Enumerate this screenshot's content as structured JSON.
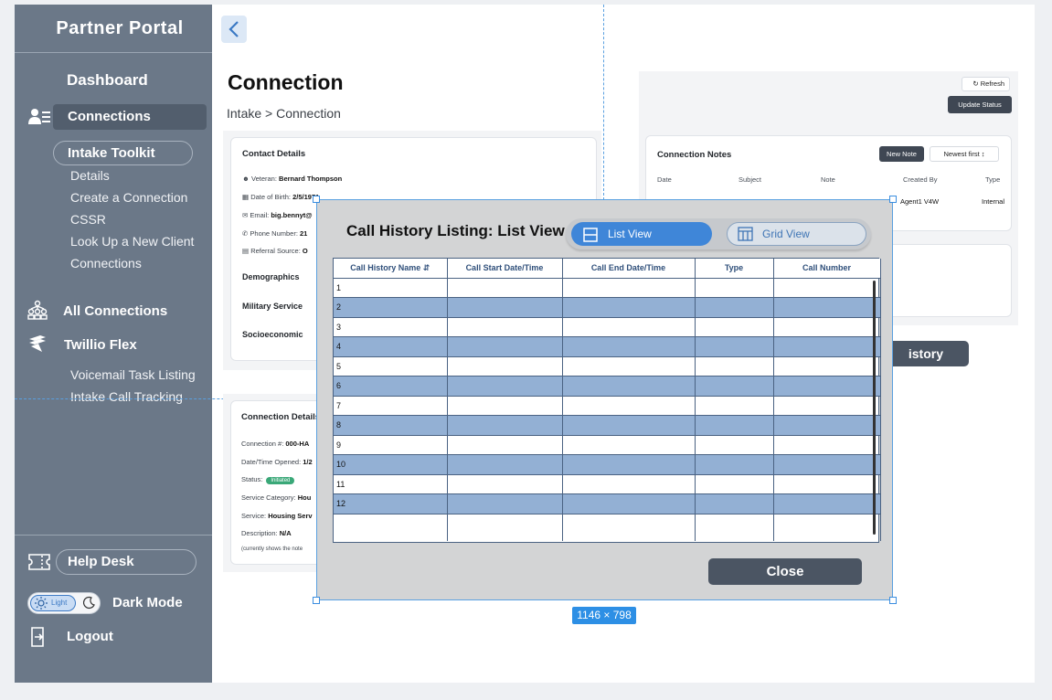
{
  "sidebar": {
    "brand": "Partner Portal",
    "dashboard": "Dashboard",
    "connections": "Connections",
    "intake_toolkit": "Intake Toolkit",
    "sub_items": [
      "Details",
      "Create a Connection",
      "CSSR",
      "Look Up a New Client",
      "Connections"
    ],
    "all_connections": "All Connections",
    "twilio_flex": "Twillio Flex",
    "flex_items": [
      "Voicemail Task Listing",
      "Intake Call Tracking"
    ],
    "help_desk": "Help Desk",
    "toggle_light": "Light",
    "dark_mode": "Dark Mode",
    "logout": "Logout"
  },
  "main": {
    "title": "Connection",
    "breadcrumb": "Intake > Connection",
    "contact": {
      "title": "Contact Details",
      "veteran_label": "Veteran:",
      "veteran": "Bernard Thompson",
      "dob_label": "Date of Birth:",
      "dob": "2/5/1971",
      "email_label": "Email:",
      "email": "big.bennyt@",
      "phone_label": "Phone Number:",
      "phone": "21",
      "referral_label": "Referral Source:",
      "referral": "O",
      "sections": [
        "Demographics",
        "Military Service",
        "Socioeconomic"
      ]
    },
    "connection": {
      "title": "Connection Details",
      "number_label": "Connection #:",
      "number": "000-HA",
      "opened_label": "Date/Time Opened:",
      "opened": "1/2",
      "status_label": "Status:",
      "status": "Initiated",
      "category_label": "Service Category:",
      "category": "Hou",
      "service_label": "Service:",
      "service": "Housing Serv",
      "description_label": "Description:",
      "description": "N/A",
      "note": "(currently shows the note"
    },
    "right": {
      "refresh": "Refresh",
      "update_status": "Update Status",
      "notes_title": "Connection Notes",
      "new_note": "New Note",
      "newest_first": "Newest first",
      "notes_columns": [
        "Date",
        "Subject",
        "Note",
        "Created By",
        "Type"
      ],
      "note_row": {
        "created_by": "Agent1 V4W",
        "type": "Internal"
      },
      "history_button": "istory"
    }
  },
  "modal": {
    "title": "Call History Listing: List View",
    "list_view": "List View",
    "grid_view": "Grid View",
    "columns": [
      "Call History Name",
      "Call Start Date/Time",
      "Call End Date/Time",
      "Type",
      "Call Number"
    ],
    "rows": [
      "1",
      "2",
      "3",
      "4",
      "5",
      "6",
      "7",
      "8",
      "9",
      "10",
      "11",
      "12"
    ],
    "close": "Close",
    "size_label": "1146 × 798"
  },
  "colors": {
    "sidebar": "#6b7888",
    "accent": "#3f86d8",
    "row_alt": "#93b0d4",
    "status_green": "#3aa878"
  }
}
